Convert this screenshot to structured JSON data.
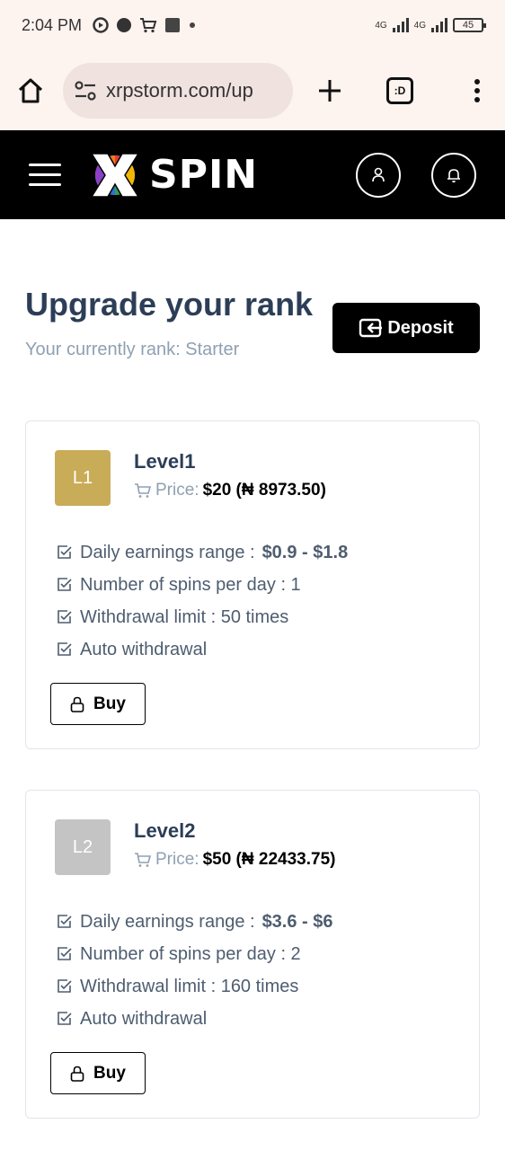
{
  "status_bar": {
    "time": "2:04 PM",
    "network1": "4G",
    "network2": "4G",
    "battery": "45"
  },
  "browser": {
    "url": "xrpstorm.com/up",
    "tab_label": ":D"
  },
  "header": {
    "logo_text": "SPIN"
  },
  "page": {
    "title": "Upgrade your rank",
    "subtitle": "Your currently rank: Starter",
    "deposit_label": "Deposit"
  },
  "levels": [
    {
      "badge": "L1",
      "badge_color": "#c9ac58",
      "name": "Level1",
      "price_label": "Price:",
      "price_value": "$20 (₦ 8973.50)",
      "earnings_label": "Daily earnings range :",
      "earnings_value": "$0.9 - $1.8",
      "spins": "Number of spins per day : 1",
      "withdrawal": "Withdrawal limit : 50 times",
      "auto": "Auto withdrawal",
      "buy_label": "Buy"
    },
    {
      "badge": "L2",
      "badge_color": "#c4c4c4",
      "name": "Level2",
      "price_label": "Price:",
      "price_value": "$50 (₦ 22433.75)",
      "earnings_label": "Daily earnings range :",
      "earnings_value": "$3.6 - $6",
      "spins": "Number of spins per day : 2",
      "withdrawal": "Withdrawal limit : 160 times",
      "auto": "Auto withdrawal",
      "buy_label": "Buy"
    }
  ]
}
